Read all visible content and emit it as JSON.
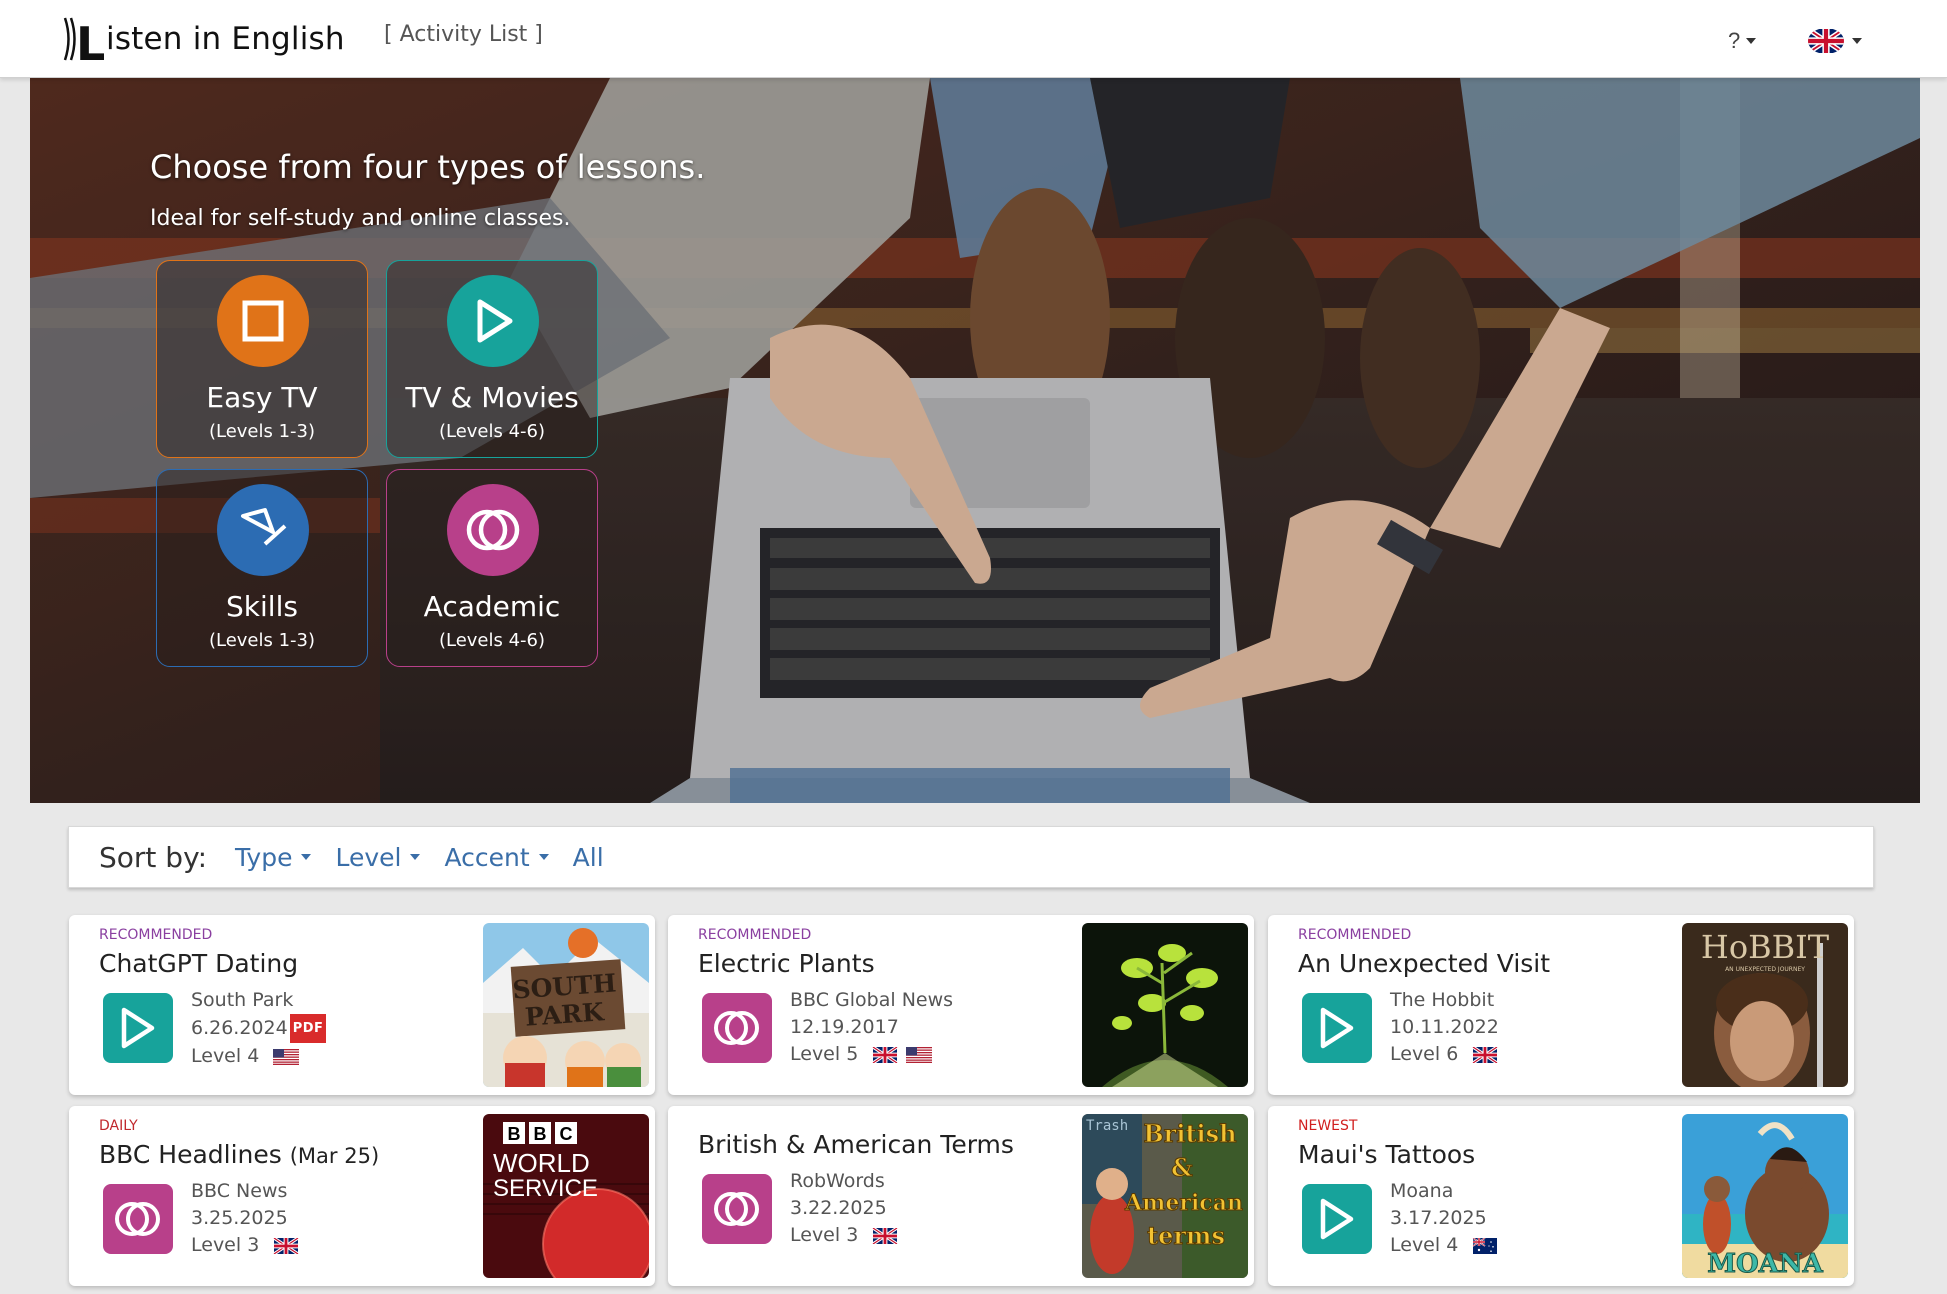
{
  "header": {
    "logo_text": "isten in English",
    "logo_letter": "L",
    "activity_link": "[ Activity List ]",
    "help_label": "?"
  },
  "hero": {
    "heading": "Choose from four types of lessons.",
    "subheading": "Ideal for self-study and online classes.",
    "lessons": [
      {
        "name": "Easy TV",
        "levels": "(Levels 1-3)",
        "color": "#e07318",
        "icon": "square-icon"
      },
      {
        "name": "TV & Movies",
        "levels": "(Levels 4-6)",
        "color": "#17a39b",
        "icon": "play-icon"
      },
      {
        "name": "Skills",
        "levels": "(Levels 1-3)",
        "color": "#2c6cb3",
        "icon": "pen-icon"
      },
      {
        "name": "Academic",
        "levels": "(Levels 4-6)",
        "color": "#b8408a",
        "icon": "rings-icon"
      }
    ]
  },
  "sort": {
    "label": "Sort by:",
    "options": [
      "Type",
      "Level",
      "Accent",
      "All"
    ]
  },
  "cards": [
    {
      "tag": "RECOMMENDED",
      "tag_color": "#8a3fa0",
      "title": "ChatGPT Dating",
      "title_small": "",
      "source": "South Park",
      "date": "6.26.2024",
      "pdf": "PDF",
      "level": "Level 4",
      "type": "tv",
      "flags": [
        "us"
      ],
      "thumb": "south-park"
    },
    {
      "tag": "RECOMMENDED",
      "tag_color": "#8a3fa0",
      "title": "Electric Plants",
      "title_small": "",
      "source": "BBC Global News",
      "date": "12.19.2017",
      "pdf": "",
      "level": "Level 5",
      "type": "academic",
      "flags": [
        "uk",
        "us"
      ],
      "thumb": "plants"
    },
    {
      "tag": "RECOMMENDED",
      "tag_color": "#8a3fa0",
      "title": "An Unexpected Visit",
      "title_small": "",
      "source": "The Hobbit",
      "date": "10.11.2022",
      "pdf": "",
      "level": "Level 6",
      "type": "tv",
      "flags": [
        "uk"
      ],
      "thumb": "hobbit"
    },
    {
      "tag": "DAILY",
      "tag_color": "#c0282d",
      "title": "BBC Headlines ",
      "title_small": "(Mar 25)",
      "source": "BBC News",
      "date": "3.25.2025",
      "pdf": "",
      "level": "Level 3",
      "type": "academic",
      "flags": [
        "uk"
      ],
      "thumb": "bbc"
    },
    {
      "tag": "",
      "tag_color": "#8a3fa0",
      "title": "British & American Terms",
      "title_small": "",
      "source": "RobWords",
      "date": "3.22.2025",
      "pdf": "",
      "level": "Level 3",
      "type": "academic",
      "flags": [
        "uk"
      ],
      "thumb": "terms"
    },
    {
      "tag": "NEWEST",
      "tag_color": "#d11f1f",
      "title": "Maui's Tattoos",
      "title_small": "",
      "source": "Moana",
      "date": "3.17.2025",
      "pdf": "",
      "level": "Level 4",
      "type": "tv",
      "flags": [
        "au"
      ],
      "thumb": "moana"
    }
  ],
  "thumb_text": {
    "south_park_1": "SOUTH",
    "south_park_2": "PARK",
    "hobbit_title": "HoBBIT",
    "hobbit_sub": "AN UNEXPECTED JOURNEY",
    "bbc_letters": [
      "B",
      "B",
      "C"
    ],
    "bbc_line1": "WORLD",
    "bbc_line2": "SERVICE",
    "terms_1": "British",
    "terms_2": "&",
    "terms_3": "American",
    "terms_4": "terms",
    "terms_bg": "Trash",
    "moana": "MOANA"
  }
}
